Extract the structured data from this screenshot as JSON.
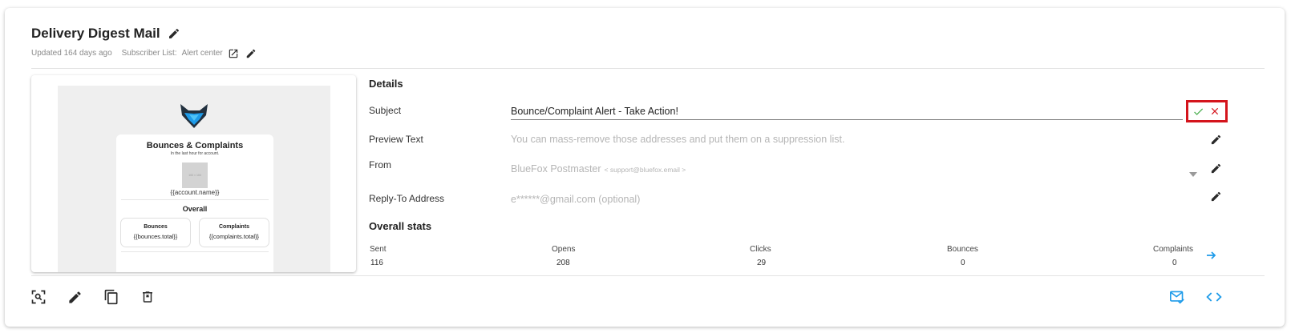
{
  "header": {
    "title": "Delivery Digest Mail",
    "updated": "Updated 164 days ago",
    "subscriber_label": "Subscriber List:",
    "subscriber_value": "Alert center"
  },
  "preview": {
    "title": "Bounces & Complaints",
    "subtitle": "In the last hour for account.",
    "image_placeholder": "100 × 100",
    "account_name": "{{account.name}}",
    "overall": "Overall",
    "boxes": [
      {
        "label": "Bounces",
        "value": "{{bounces.total}}"
      },
      {
        "label": "Complaints",
        "value": "{{complaints.total}}"
      }
    ]
  },
  "details": {
    "title": "Details",
    "subject_label": "Subject",
    "subject_value": "Bounce/Complaint Alert - Take Action!",
    "preview_label": "Preview Text",
    "preview_value": "You can mass-remove those addresses and put them on a suppression list.",
    "from_label": "From",
    "from_name": "BlueFox Postmaster",
    "from_email": "< support@bluefox.email >",
    "reply_label": "Reply-To Address",
    "reply_value": "e******@gmail.com (optional)"
  },
  "stats": {
    "title": "Overall stats",
    "items": [
      {
        "label": "Sent",
        "value": "116"
      },
      {
        "label": "Opens",
        "value": "208"
      },
      {
        "label": "Clicks",
        "value": "29"
      },
      {
        "label": "Bounces",
        "value": "0"
      },
      {
        "label": "Complaints",
        "value": "0"
      }
    ]
  },
  "colors": {
    "accent": "#1e9be9",
    "confirm": "#4caf50",
    "cancel": "#d4141c",
    "highlight": "#d4141c",
    "icon": "#2a2a2a"
  },
  "icons": {
    "title_edit": "pencil-icon",
    "external_link": "open-in-new-icon",
    "confirm": "check-icon",
    "cancel": "close-icon",
    "dropdown": "caret-down-icon",
    "stats_arrow": "arrow-right-icon",
    "preview": "zoom-preview-icon",
    "edit": "pencil-icon",
    "copy": "copy-icon",
    "delete": "trash-icon",
    "send_test": "mail-check-icon",
    "code": "code-icon"
  }
}
